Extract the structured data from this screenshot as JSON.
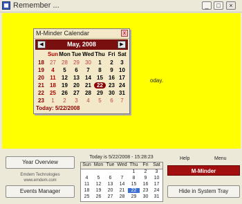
{
  "window": {
    "title": "Remember ...",
    "controls": [
      "_",
      "□",
      "×"
    ]
  },
  "background_text": "oday.",
  "popup": {
    "title": "M-Minder Calendar",
    "month_label": "May, 2008",
    "prev": "◀",
    "next": "▶",
    "days": [
      "Sun",
      "Mon",
      "Tue",
      "Wed",
      "Thu",
      "Fri",
      "Sat"
    ],
    "weeks": [
      {
        "wk": "18",
        "d": [
          "27",
          "28",
          "29",
          "30",
          "1",
          "2",
          "3"
        ]
      },
      {
        "wk": "19",
        "d": [
          "4",
          "5",
          "6",
          "7",
          "8",
          "9",
          "10"
        ]
      },
      {
        "wk": "20",
        "d": [
          "11",
          "12",
          "13",
          "14",
          "15",
          "16",
          "17"
        ]
      },
      {
        "wk": "21",
        "d": [
          "18",
          "19",
          "20",
          "21",
          "22",
          "23",
          "24"
        ]
      },
      {
        "wk": "22",
        "d": [
          "25",
          "26",
          "27",
          "28",
          "29",
          "30",
          "31"
        ]
      },
      {
        "wk": "23",
        "d": [
          "1",
          "2",
          "3",
          "4",
          "5",
          "6",
          "7"
        ]
      }
    ],
    "today_label": "Today: 5/22/2008"
  },
  "bottom": {
    "year_overview": "Year Overview",
    "company": "Emdem Technologies",
    "website": "www.emdem.com",
    "events_manager": "Events Manager",
    "today_line": "Today is 5/22/2008 - 15:28:23",
    "help": "Help",
    "menu": "Menu",
    "mminder": "M-Minder",
    "hide_tray": "Hide in System Tray",
    "mini_days": [
      "Sun",
      "Mon",
      "Tue",
      "Wed",
      "Thu",
      "Fri",
      "Sat"
    ],
    "mini_weeks": [
      [
        "",
        "",
        "",
        "",
        "1",
        "2",
        "3"
      ],
      [
        "4",
        "5",
        "6",
        "7",
        "8",
        "9",
        "10"
      ],
      [
        "11",
        "12",
        "13",
        "14",
        "15",
        "16",
        "17"
      ],
      [
        "18",
        "19",
        "20",
        "21",
        "22",
        "23",
        "24"
      ],
      [
        "25",
        "26",
        "27",
        "28",
        "29",
        "30",
        "31"
      ]
    ]
  },
  "colors": {
    "yellow": "#FFFF00",
    "dark_red": "#7A0F0F",
    "accent_red": "#A20F0F"
  }
}
